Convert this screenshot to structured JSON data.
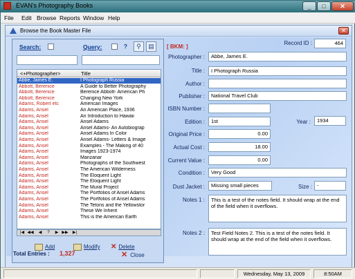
{
  "window": {
    "title": "EVAN's Photography Books"
  },
  "menu": [
    "File",
    "Edit",
    "Browse",
    "Reports",
    "Window",
    "Help"
  ],
  "child": {
    "title": "Browse the Book Master File"
  },
  "search": {
    "search_label": "Search:",
    "query_label": "Query:",
    "help_label": "?",
    "search_value": "",
    "query_value": ""
  },
  "grid": {
    "headers": [
      "<+Photographer>",
      "Title"
    ],
    "rows": [
      {
        "photographer": "Abbe, James E.",
        "title": "I Photograph Russia"
      },
      {
        "photographer": "Abbott, Berenice",
        "title": "A Guide to Better Photography"
      },
      {
        "photographer": "Abbott, Berenice",
        "title": "Berenice Abbott- American Ph"
      },
      {
        "photographer": "Abbott, Berenice",
        "title": "Changing New York"
      },
      {
        "photographer": "Adams, Robert  etc",
        "title": "American Images"
      },
      {
        "photographer": "Adams, Ansel",
        "title": "An American Place, 1936"
      },
      {
        "photographer": "Adams, Ansel",
        "title": "An Introduction to Hawaii"
      },
      {
        "photographer": "Adams, Ansel",
        "title": "Ansel Adams"
      },
      {
        "photographer": "Adams, Ansel",
        "title": "Ansel Adams- An Autobiograp"
      },
      {
        "photographer": "Adams, Ansel",
        "title": "Ansel Adams In Color"
      },
      {
        "photographer": "Adams, Ansel",
        "title": "Ansel Adams- Letters & Image"
      },
      {
        "photographer": "Adams, Ansel",
        "title": "Examples - The Making of 40"
      },
      {
        "photographer": "Adams, Ansel",
        "title": "Images 1923-1974"
      },
      {
        "photographer": "Adams, Ansel",
        "title": "Manzanar"
      },
      {
        "photographer": "Adams, Ansel",
        "title": "Photographs of the Southwest"
      },
      {
        "photographer": "Adams, Ansel",
        "title": "The American Wilderness"
      },
      {
        "photographer": "Adams, Ansel",
        "title": "The Eloquent Light"
      },
      {
        "photographer": "Adams, Ansel",
        "title": "The Eloquent Light"
      },
      {
        "photographer": "Adams, Ansel",
        "title": "The Mural Project"
      },
      {
        "photographer": "Adams, Ansel",
        "title": "The Portfolios of Ansel Adams"
      },
      {
        "photographer": "Adams, Ansel",
        "title": "The Portfolios of Ansel Adams"
      },
      {
        "photographer": "Adams, Ansel",
        "title": "The Tetons and the Yellowstor"
      },
      {
        "photographer": "Adams, Ansel",
        "title": "These We Inherit"
      },
      {
        "photographer": "Adams, Ansel",
        "title": "This is the American Earth"
      }
    ]
  },
  "nav": [
    "|◀",
    "◀◀",
    "◀",
    "?",
    "▶",
    "▶▶",
    "▶|"
  ],
  "actions": {
    "add": "Add",
    "modify": "Modify",
    "delete": "Delete",
    "close": "Close"
  },
  "total": {
    "label": "Total Entries :",
    "value": "1,327"
  },
  "record": {
    "bkm_label": "[ BKM: ]",
    "record_id_label": "Record ID :",
    "record_id": "464",
    "photographer_label": "Photographer :",
    "photographer": "Abbe, James E.",
    "title_label": "Title :",
    "title": "I Photograph Russia",
    "author_label": "Author :",
    "author": "",
    "publisher_label": "Publisher :",
    "publisher": "National Travel Club",
    "isbn_label": "ISBN Number :",
    "isbn": "",
    "edition_label": "Edition :",
    "edition": "1st",
    "year_label": "Year :",
    "year": "1934",
    "original_price_label": "Original Price :",
    "original_price": "0.00",
    "actual_cost_label": "Actual Cost :",
    "actual_cost": "18.00",
    "current_value_label": "Current Value :",
    "current_value": "0.00",
    "condition_label": "Condition :",
    "condition": "Very Good",
    "dust_jacket_label": "Dust Jacket :",
    "dust_jacket": "Missing small pieces",
    "size_label": "Size :",
    "size": "-",
    "notes1_label": "Notes 1 :",
    "notes1": "This is a test of the notes field. It should wrap at the end of the field when it overflows.",
    "notes2_label": "Notes 2 :",
    "notes2": "Test Field Notes 2. This is a test of the notes field. It should wrap at the end of the field when it overflows."
  },
  "status": {
    "date": "Wednesday, May 13, 2009",
    "time": "8:50AM"
  }
}
